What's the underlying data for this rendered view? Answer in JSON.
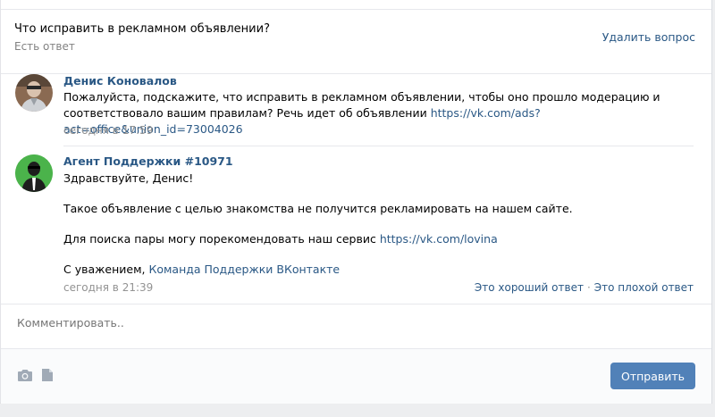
{
  "question": {
    "title": "Что исправить в рекламном объявлении?",
    "status": "Есть ответ",
    "delete_label": "Удалить вопрос"
  },
  "messages": [
    {
      "author": "Денис Коновалов",
      "text_before_link": "Пожалуйста, подскажите, что исправить в рекламном объявлении, чтобы оно прошло модерацию и соответствовало вашим правилам? Речь идет об объявлении ",
      "link": "https://vk.com/ads?act=office&union_id=73004026",
      "time": "сегодня в 17:59"
    },
    {
      "author": "Агент Поддержки #10971",
      "greeting": "Здравствуйте, Денис!",
      "paragraph1": "Такое объявление с целью знакомства не получится рекламировать на нашем сайте.",
      "paragraph2_before_link": "Для поиска пары могу порекомендовать наш сервис ",
      "paragraph2_link": "https://vk.com/lovina",
      "signature_before_link": "С уважением, ",
      "signature_link": "Команда Поддержки ВКонтакте",
      "time": "сегодня в 21:39",
      "rate_good": "Это хороший ответ",
      "rate_separator": "·",
      "rate_bad": "Это плохой ответ"
    }
  ],
  "comment": {
    "placeholder": "Комментировать.."
  },
  "toolbar": {
    "photo_icon": "camera-icon",
    "doc_icon": "document-icon",
    "send_label": "Отправить"
  },
  "colors": {
    "link": "#2a5885",
    "button": "#5181b8",
    "agent_avatar": "#4bb34b"
  }
}
